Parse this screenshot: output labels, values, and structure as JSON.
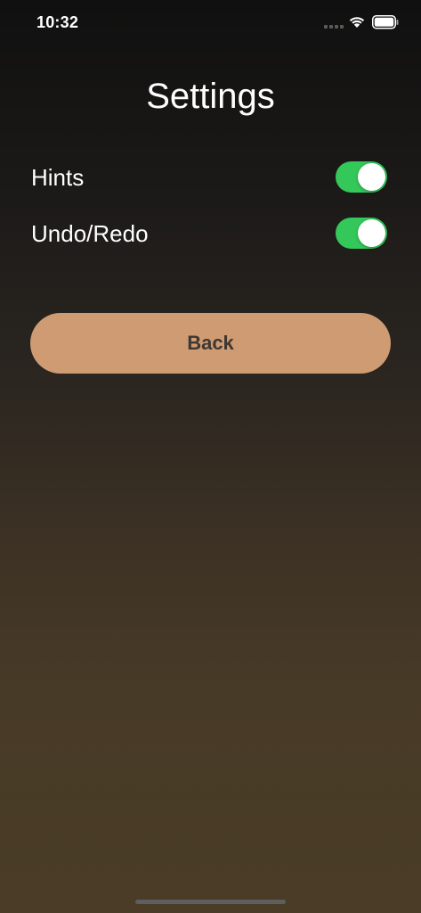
{
  "status_bar": {
    "time": "10:32",
    "icons": [
      "signal-icon",
      "wifi-icon",
      "battery-icon"
    ]
  },
  "page": {
    "title": "Settings"
  },
  "settings": [
    {
      "label": "Hints",
      "enabled": true
    },
    {
      "label": "Undo/Redo",
      "enabled": true
    }
  ],
  "back_button": {
    "label": "Back"
  },
  "colors": {
    "toggle_on": "#34c759",
    "button_bg": "#cf9b73",
    "button_text": "#3f3732"
  }
}
